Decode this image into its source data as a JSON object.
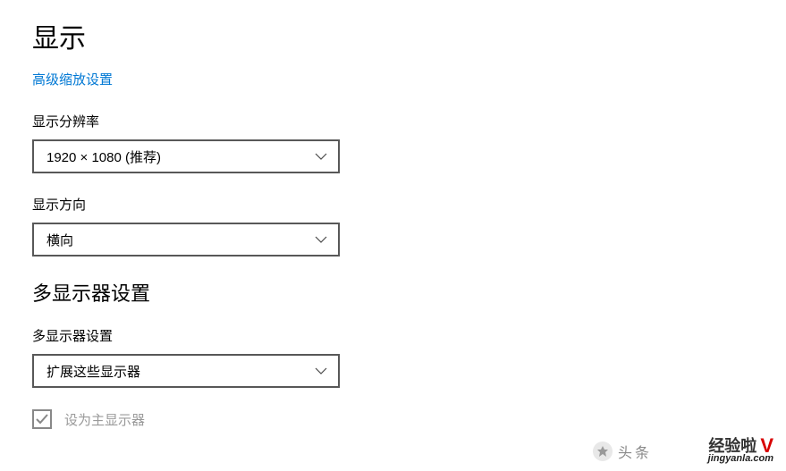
{
  "header": {
    "title": "显示"
  },
  "links": {
    "advanced_scaling": "高级缩放设置"
  },
  "resolution": {
    "label": "显示分辨率",
    "value": "1920 × 1080 (推荐)"
  },
  "orientation": {
    "label": "显示方向",
    "value": "横向"
  },
  "multi": {
    "section_title": "多显示器设置",
    "label": "多显示器设置",
    "value": "扩展这些显示器"
  },
  "checkbox": {
    "label": "设为主显示器",
    "checked": true,
    "disabled": true
  },
  "watermark": {
    "brand_text": "经验啦",
    "accent": "V",
    "url": "jingyanla.com",
    "source": "头条"
  },
  "colors": {
    "link": "#0078d4",
    "border": "#585858"
  }
}
